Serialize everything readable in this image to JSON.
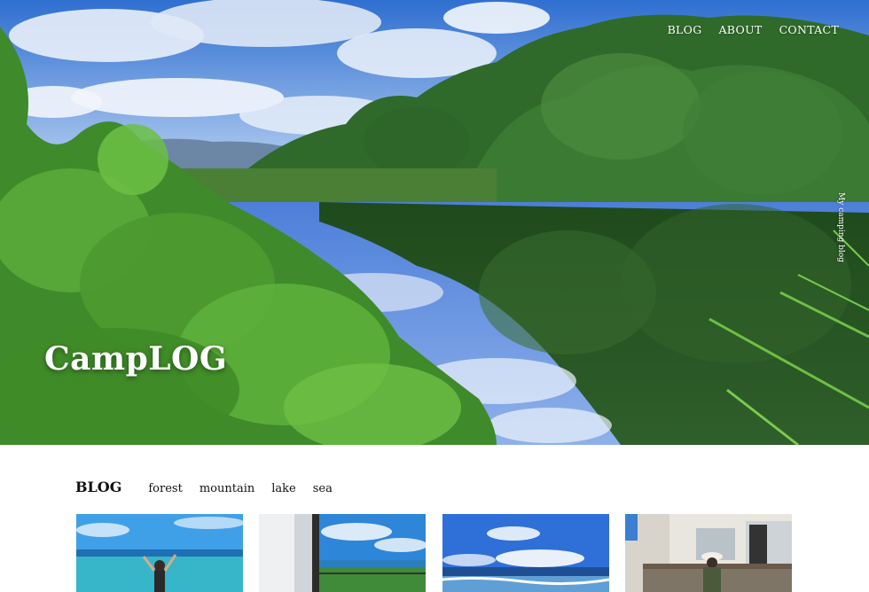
{
  "nav": {
    "items": [
      {
        "label": "BLOG"
      },
      {
        "label": "ABOUT"
      },
      {
        "label": "CONTACT"
      }
    ]
  },
  "hero": {
    "title": "CampLOG",
    "tagline": "My camping blog"
  },
  "blog": {
    "heading": "BLOG",
    "categories": [
      {
        "label": "forest"
      },
      {
        "label": "mountain"
      },
      {
        "label": "lake"
      },
      {
        "label": "sea"
      }
    ]
  },
  "colors": {
    "sky": "#3f7fd8",
    "forest": "#2f5f2a",
    "nav_text": "#ffffff",
    "page_bg": "#ffffff"
  }
}
